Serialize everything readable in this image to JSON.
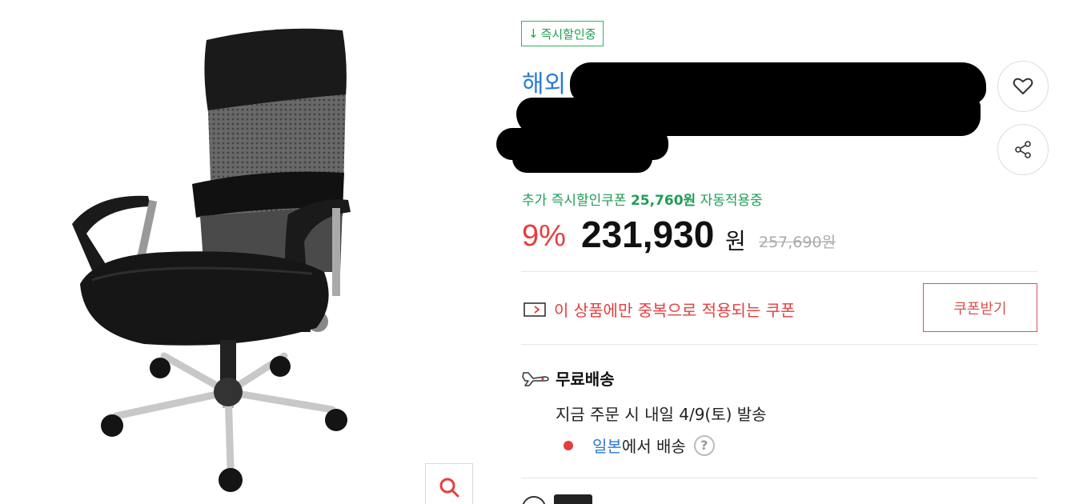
{
  "product": {
    "badge": "즉시할인중",
    "title_visible": "해외",
    "coupon_line": {
      "prefix": "추가 즉시할인쿠폰",
      "amount": "25,760원",
      "suffix": "자동적용중"
    },
    "price": {
      "discount": "9%",
      "sale_price": "231,930",
      "currency": "원",
      "original_price": "257,690원"
    },
    "duplicate_coupon": {
      "text": "이 상품에만 중복으로 적용되는 쿠폰",
      "button_label": "쿠폰받기"
    },
    "shipping": {
      "title": "무료배송",
      "date_text": "지금 주문 시 내일 4/9(토) 발송",
      "origin_country": "일본",
      "origin_suffix": "에서 배송",
      "help_glyph": "?"
    }
  },
  "icons": {
    "badge": "down-arrow-icon",
    "wish": "heart-icon",
    "share": "share-icon",
    "zoom": "search-icon",
    "coupon": "coupon-icon",
    "shipping": "airplane-icon"
  },
  "colors": {
    "accent_red": "#e53e3e",
    "accent_green": "#1f9d55",
    "link_blue": "#2b7bd1"
  }
}
